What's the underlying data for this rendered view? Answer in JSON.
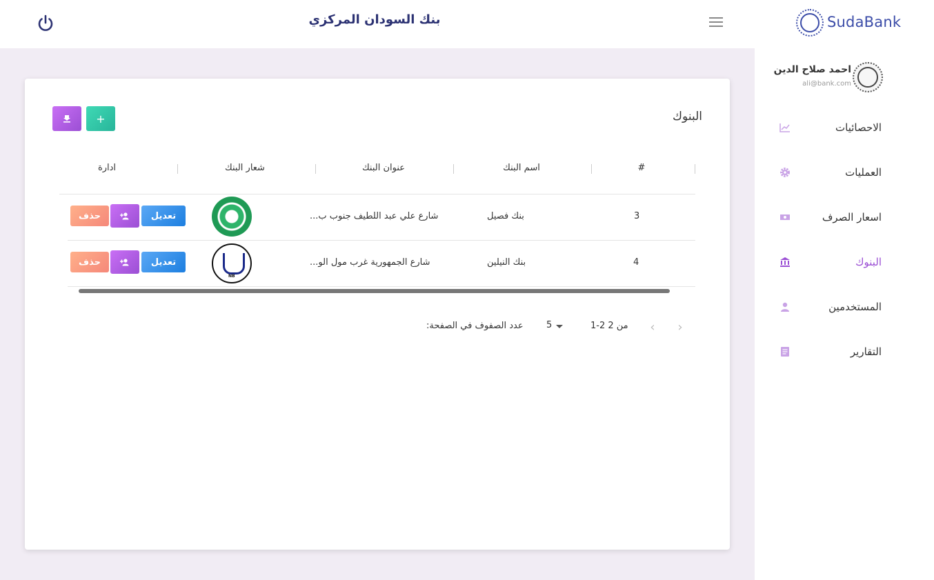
{
  "brand": {
    "name": "SudaBank"
  },
  "header": {
    "title": "بنك السودان المركزي"
  },
  "profile": {
    "name": "احمد صلاح الدين",
    "email": "ali@bank.com"
  },
  "sidebar": {
    "items": [
      {
        "label": "الاحصائيات",
        "icon": "chart-line-icon"
      },
      {
        "label": "العمليات",
        "icon": "gear-icon"
      },
      {
        "label": "اسعار الصرف",
        "icon": "money-icon"
      },
      {
        "label": "البنوك",
        "icon": "bank-icon",
        "active": true
      },
      {
        "label": "المستخدمين",
        "icon": "person-icon"
      },
      {
        "label": "التقارير",
        "icon": "report-icon"
      }
    ]
  },
  "card": {
    "title": "البنوك",
    "download_icon": "download-icon",
    "add_label": "+"
  },
  "table": {
    "headers": [
      "#",
      "اسم البنك",
      "عنوان البنك",
      "شعار البنك",
      "ادارة"
    ],
    "rows": [
      {
        "id": "3",
        "name": "بنك فصيل",
        "address": "شارع علي عبد اللطيف جنوب ب...",
        "logo": "faisal-bank-logo"
      },
      {
        "id": "4",
        "name": "بنك النيلين",
        "address": "شارع الجمهورية غرب مول الو...",
        "logo": "nilein-bank-logo"
      }
    ],
    "edit_label": "تعديل",
    "delete_label": "حذف"
  },
  "pagination": {
    "rows_label": "عدد الصفوف في الصفحة:",
    "rows_per_page": "5",
    "range": "1-2 من 2"
  },
  "colors": {
    "accent": "#9b4fd4",
    "header_title": "#2c3273",
    "brand": "#3b4ca8",
    "background": "#f1ecf4"
  }
}
